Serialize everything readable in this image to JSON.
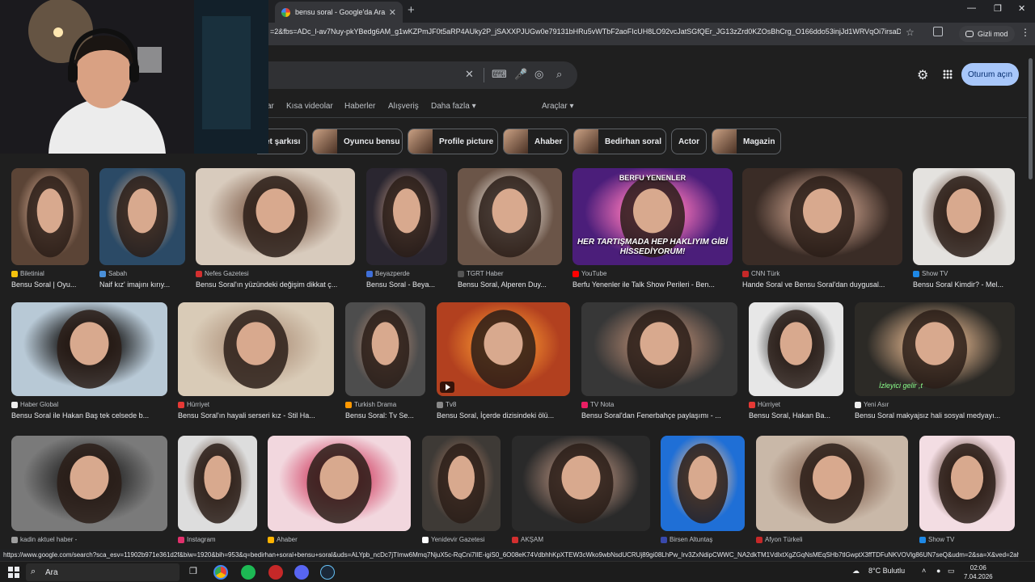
{
  "browser": {
    "tab_title": "bensu soral - Google'da Ara",
    "tab_close": "✕",
    "new_tab": "+",
    "url": "=2&fbs=ADc_l-av7Nuy-pkYBedg6AM_g1wKZPmJF0t5aRP4AUky2P_jSAXXPJUGw0e79131bHRu5vWTbF2aoFIcUH8LO92vcJatSGfQEr_JG13zZrd0KZOsBhCrg_O166ddo53injJd1WRVqOi7irsaDz...",
    "incognito_label": "Gizli mod",
    "window_controls": [
      "—",
      "❐",
      "✕"
    ]
  },
  "google": {
    "signin_label": "Oturum açın",
    "nav_tabs": [
      "ar",
      "Kısa videolar",
      "Haberler",
      "Alışveriş",
      "Daha fazla ▾",
      "Araçlar ▾"
    ],
    "chips": [
      "et şarkısı",
      "Oyuncu bensu",
      "Profile picture",
      "Ahaber",
      "Bedirhan soral",
      "Actor",
      "Magazin"
    ]
  },
  "results": [
    {
      "source": "Biletinial",
      "title": "Bensu Soral | Oyu...",
      "fav": "#f4c20d"
    },
    {
      "source": "Sabah",
      "title": "Naif kız' imajını kırıy...",
      "fav": "#4a90d9"
    },
    {
      "source": "Nefes Gazetesi",
      "title": "Bensu Soral'ın yüzündeki değişim dikkat ç...",
      "fav": "#d32f2f"
    },
    {
      "source": "Beyazperde",
      "title": "Bensu Soral - Beya...",
      "fav": "#3f6fd8"
    },
    {
      "source": "TGRT Haber",
      "title": "Bensu Soral, Alperen Duy...",
      "fav": "#555555"
    },
    {
      "source": "YouTube",
      "title": "Berfu Yenenler ile Talk Show Perileri - Ben...",
      "fav": "#ff0000",
      "overlay": "HER TARTIŞMADA HEP HAKLIYIM GİBİ HİSSEDİYORUM!",
      "overlay_top": "BERFU YENENLER"
    },
    {
      "source": "CNN Türk",
      "title": "Hande Soral ve Bensu Soral'dan duygusal...",
      "fav": "#c62828"
    },
    {
      "source": "Show TV",
      "title": "Bensu Soral Kimdir? - Mel...",
      "fav": "#1e88e5"
    },
    {
      "source": "Haber Global",
      "title": "Bensu Soral ile Hakan Baş tek celsede b...",
      "fav": "#eeeeee"
    },
    {
      "source": "Hürriyet",
      "title": "Bensu Soral'ın hayali serseri kız - Stil Ha...",
      "fav": "#e53935"
    },
    {
      "source": "Turkish Drama",
      "title": "Bensu Soral: Tv Se...",
      "fav": "#ff9800"
    },
    {
      "source": "Tv8",
      "title": "Bensu Soral, İçerde dizisindeki ölü...",
      "fav": "#888888"
    },
    {
      "source": "TV Nota",
      "title": "Bensu Soral'dan Fenerbahçe paylaşımı - ...",
      "fav": "#e91e63"
    },
    {
      "source": "Hürriyet",
      "title": "Bensu Soral, Hakan Ba...",
      "fav": "#e53935"
    },
    {
      "source": "Yeni Asır",
      "title": "Bensu Soral makyajsız hali sosyal medyayı...",
      "fav": "#eeeeee",
      "caption": "İzleyici gelir ,t"
    },
    {
      "source": "kadin aktuel haber -",
      "title": "",
      "fav": "#9e9e9e"
    },
    {
      "source": "Instagram",
      "title": "",
      "fav": "#e1306c"
    },
    {
      "source": "Ahaber",
      "title": "",
      "fav": "#ffb300"
    },
    {
      "source": "Yenidevir Gazetesi",
      "title": "",
      "fav": "#ffffff"
    },
    {
      "source": "AKŞAM",
      "title": "",
      "fav": "#d32f2f"
    },
    {
      "source": "Birsen Altuntaş",
      "title": "",
      "fav": "#3949ab"
    },
    {
      "source": "Afyon Türkeli",
      "title": "",
      "fav": "#c62828"
    },
    {
      "source": "Show TV",
      "title": "",
      "fav": "#1e88e5"
    }
  ],
  "status_url": "https://www.google.com/search?sca_esv=11902b971e361d2f&biw=1920&bih=953&q=bedirhan+soral+bensu+soral&uds=ALYpb_ncDc7jTImw6Mmq7NjuX5c-RqCni7IlE-igiS0_6O08eK74VdbhhKpXTEW3cWko9wbNsdUCRUj89gi08LhPw_lrv3ZxNdipCWWC_NA2dkTM1VdlxtXgZGqNsMEqSHb7tlGwptX3ffTDFuNKVOVlg86UN7seQ&udm=2&sa=X&ved=2ah...",
  "taskbar": {
    "search_label": "Ara",
    "weather": "8°C  Bulutlu",
    "time": "02:06",
    "date": "7.04.2026"
  }
}
